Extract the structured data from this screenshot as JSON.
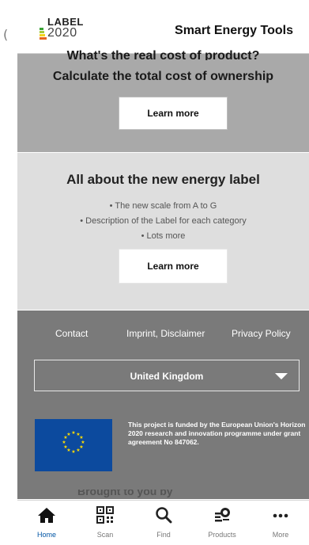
{
  "header": {
    "logo_top": "LABEL",
    "logo_bottom": "2020",
    "title": "Smart Energy Tools"
  },
  "cost_section": {
    "heading_partial": "What's the real cost of product?",
    "heading": "Calculate the total cost of ownership",
    "button": "Learn more"
  },
  "label_section": {
    "title": "All about the new energy label",
    "bullets": [
      "• The new scale from A to G",
      "• Description of the Label for each category",
      "• Lots more"
    ],
    "button": "Learn more"
  },
  "footer": {
    "links": [
      "Contact",
      "Imprint, Disclaimer",
      "Privacy Policy"
    ],
    "country": "United Kingdom",
    "eu_text": "This project is funded by the European Union's Horizon 2020 research and innovation programme under grant agreement No 847062.",
    "cut_text": "Brought to you by"
  },
  "bottom_nav": [
    {
      "label": "Home",
      "icon": "home-icon"
    },
    {
      "label": "Scan",
      "icon": "qr-code-icon"
    },
    {
      "label": "Find",
      "icon": "search-icon"
    },
    {
      "label": "Products",
      "icon": "products-icon"
    },
    {
      "label": "More",
      "icon": "more-icon"
    }
  ],
  "colors": {
    "accent": "#0055a5",
    "cost_bg": "#a9a9a9",
    "label_bg": "#dedede",
    "footer_bg": "#7a7a7a",
    "eu_blue": "#0c4a9e"
  }
}
